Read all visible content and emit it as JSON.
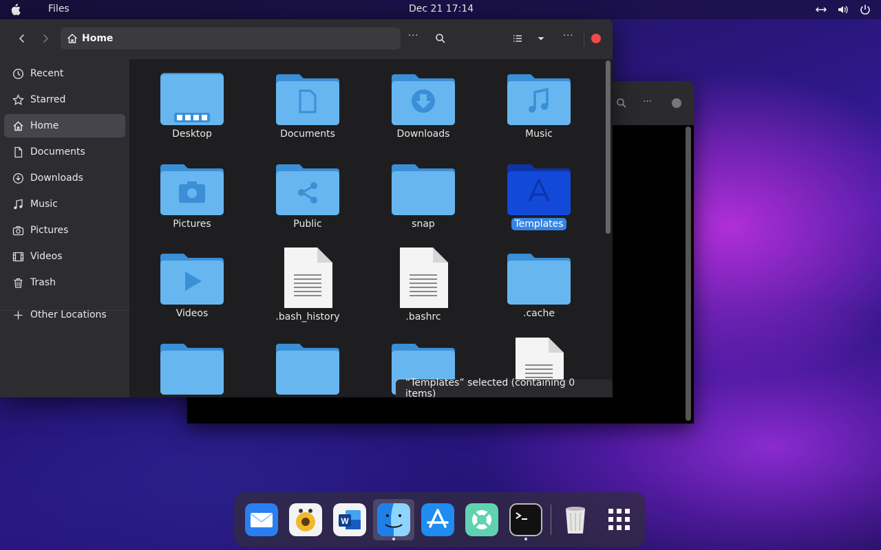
{
  "topbar": {
    "app_name": "Files",
    "clock": "Dec 21  17:14"
  },
  "window": {
    "path": "Home",
    "sidebar": [
      {
        "label": "Recent",
        "icon": "clock-icon"
      },
      {
        "label": "Starred",
        "icon": "star-icon"
      },
      {
        "label": "Home",
        "icon": "home-icon",
        "active": true
      },
      {
        "label": "Documents",
        "icon": "document-icon"
      },
      {
        "label": "Downloads",
        "icon": "download-icon"
      },
      {
        "label": "Music",
        "icon": "music-icon"
      },
      {
        "label": "Pictures",
        "icon": "camera-icon"
      },
      {
        "label": "Videos",
        "icon": "film-icon"
      },
      {
        "label": "Trash",
        "icon": "trash-icon"
      }
    ],
    "other_locations": "Other Locations",
    "items": [
      {
        "name": "Desktop",
        "kind": "desktop"
      },
      {
        "name": "Documents",
        "kind": "documents"
      },
      {
        "name": "Downloads",
        "kind": "downloads"
      },
      {
        "name": "Music",
        "kind": "music"
      },
      {
        "name": "Pictures",
        "kind": "pictures"
      },
      {
        "name": "Public",
        "kind": "public"
      },
      {
        "name": "snap",
        "kind": "folder"
      },
      {
        "name": "Templates",
        "kind": "templates",
        "selected": true
      },
      {
        "name": "Videos",
        "kind": "videos"
      },
      {
        "name": ".bash_history",
        "kind": "file"
      },
      {
        "name": ".bashrc",
        "kind": "file"
      },
      {
        "name": ".cache",
        "kind": "folder"
      }
    ],
    "status": "“Templates” selected  (containing 0 items)"
  },
  "colors": {
    "folder": "#68b6f0",
    "folder_tab": "#3a8fd6",
    "selected_folder": "#1249d8",
    "accent": "#3584e4",
    "close": "#ed4a4a"
  },
  "dock": [
    "mail",
    "rhythmbox",
    "word",
    "finder",
    "app-store",
    "help",
    "terminal",
    "trash",
    "app-grid"
  ]
}
